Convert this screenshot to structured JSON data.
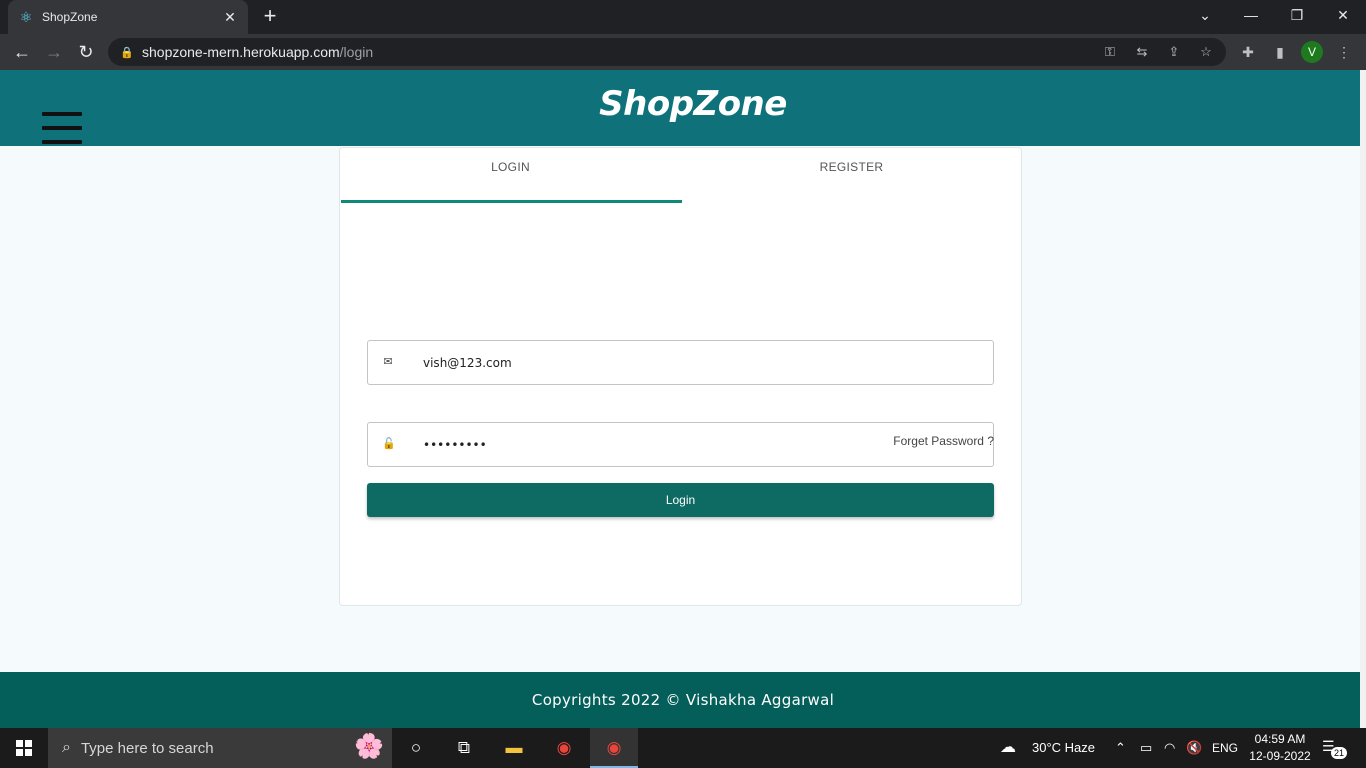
{
  "browser": {
    "tab_title": "ShopZone",
    "tab_close": "✕",
    "new_tab": "+",
    "url_host": "shopzone-mern.herokuapp.com",
    "url_path": "/login",
    "profile_initial": "V"
  },
  "header": {
    "brand": "ShopZone"
  },
  "auth": {
    "tabs": [
      "LOGIN",
      "REGISTER"
    ],
    "active_tab": "LOGIN",
    "email_value": "vish@123.com",
    "password_value": "•••••••••",
    "forget_password": "Forget Password ?",
    "login_button": "Login"
  },
  "footer": {
    "text": "Copyrights 2022 © Vishakha Aggarwal"
  },
  "taskbar": {
    "search_placeholder": "Type here to search",
    "weather": "30°C  Haze",
    "language": "ENG",
    "time": "04:59 AM",
    "date": "12-09-2022",
    "notifications": "21"
  },
  "colors": {
    "header": "#0f727b",
    "footer": "#045e5a",
    "login_button": "#0e6b63",
    "tab_indicator": "#0f8a7a"
  }
}
